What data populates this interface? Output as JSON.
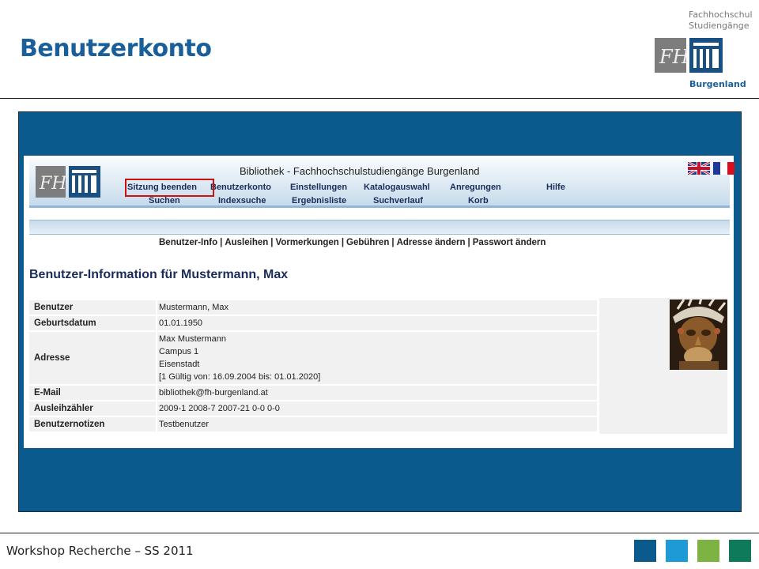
{
  "slide": {
    "title": "Benutzerkonto",
    "logo_line1": "Fachhochschul",
    "logo_line2": "Studiengänge",
    "logo_bottom": "Burgenland",
    "footer": "Workshop Recherche – SS 2011"
  },
  "colors": {
    "slide_title": "#1a5f9a",
    "frame_bg": "#0b5a8e",
    "highlight": "#cc1111",
    "squares": [
      "#0b5a8e",
      "#1e9ad6",
      "#7cb342",
      "#0e7a5a"
    ]
  },
  "library": {
    "title": "Bibliothek - Fachhochschulstudiengänge Burgenland",
    "nav_top": [
      "Sitzung beenden",
      "Benutzerkonto",
      "Einstellungen",
      "Katalogauswahl",
      "Anregungen",
      "Hilfe"
    ],
    "nav_bottom": [
      "Suchen",
      "Indexsuche",
      "Ergebnisliste",
      "Suchverlauf",
      "Korb"
    ],
    "subnav": [
      "Benutzer-Info",
      "Ausleihen",
      "Vormerkungen",
      "Gebühren",
      "Adresse ändern",
      "Passwort ändern"
    ],
    "subnav_sep": "|",
    "heading": "Benutzer-Information für Mustermann, Max",
    "fields": {
      "benutzer": {
        "label": "Benutzer",
        "value": "Mustermann, Max"
      },
      "geburtsdatum": {
        "label": "Geburtsdatum",
        "value": "01.01.1950"
      },
      "adresse": {
        "label": "Adresse",
        "lines": [
          "Max Mustermann",
          "Campus 1",
          "Eisenstadt",
          "[1 Gültig von: 16.09.2004 bis: 01.01.2020]"
        ]
      },
      "email": {
        "label": "E-Mail",
        "value": "bibliothek@fh-burgenland.at"
      },
      "ausleihzaehler": {
        "label": "Ausleihzähler",
        "value": "2009-1 2008-7 2007-21 0-0 0-0"
      },
      "notizen": {
        "label": "Benutzernotizen",
        "value": "Testbenutzer"
      }
    },
    "icons": [
      "fh-logo-icon",
      "uk-flag-icon",
      "fr-flag-icon",
      "user-photo"
    ]
  }
}
